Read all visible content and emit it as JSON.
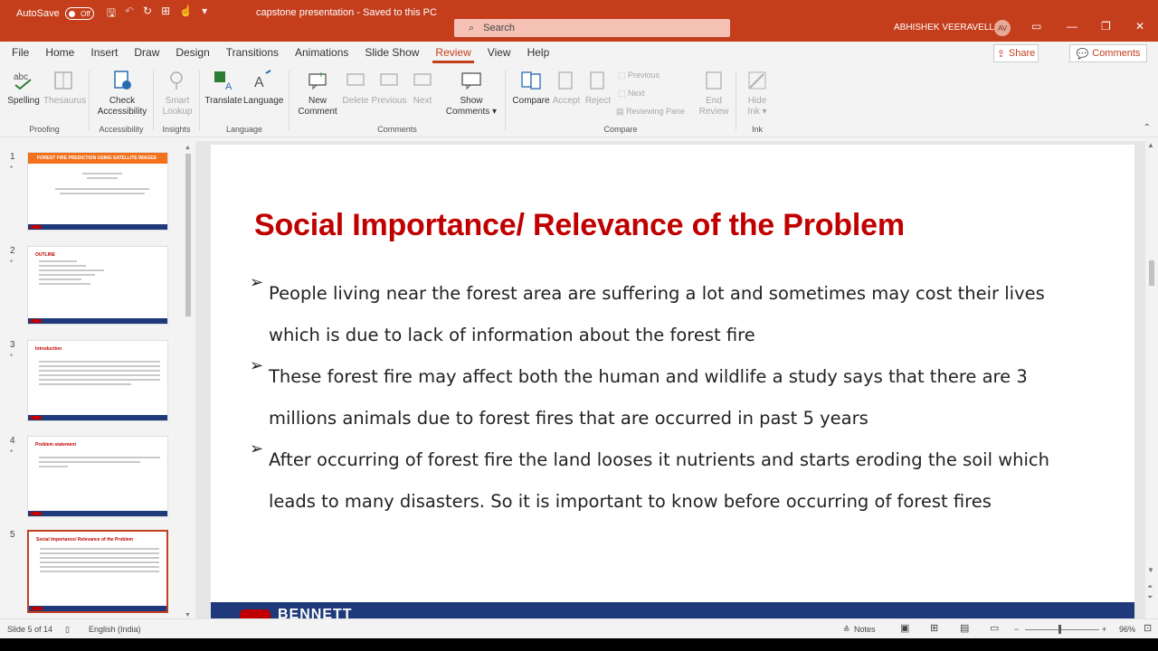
{
  "titlebar": {
    "autosave_label": "AutoSave",
    "autosave_state": "Off",
    "doc_title": "capstone presentation  -  Saved to this PC",
    "search_placeholder": "Search",
    "user_name": "ABHISHEK VEERAVELLI",
    "user_initials": "AV",
    "color": "#c43e1c"
  },
  "tabs": [
    "File",
    "Home",
    "Insert",
    "Draw",
    "Design",
    "Transitions",
    "Animations",
    "Slide Show",
    "Review",
    "View",
    "Help"
  ],
  "active_tab": "Review",
  "share_label": "Share",
  "comments_label": "Comments",
  "ribbon": {
    "proofing": {
      "label": "Proofing",
      "spelling": "Spelling",
      "thesaurus": "Thesaurus"
    },
    "accessibility": {
      "label": "Accessibility",
      "check_1": "Check",
      "check_2": "Accessibility"
    },
    "insights": {
      "label": "Insights",
      "smart_1": "Smart",
      "smart_2": "Lookup"
    },
    "language": {
      "label": "Language",
      "translate": "Translate",
      "language": "Language"
    },
    "comments": {
      "label": "Comments",
      "new_1": "New",
      "new_2": "Comment",
      "delete": "Delete",
      "previous": "Previous",
      "next": "Next",
      "show_1": "Show",
      "show_2": "Comments"
    },
    "compare": {
      "label": "Compare",
      "compare": "Compare",
      "accept": "Accept",
      "reject": "Reject",
      "previous": "Previous",
      "next": "Next",
      "reviewing_pane": "Reviewing Pane",
      "end_1": "End",
      "end_2": "Review"
    },
    "ink": {
      "label": "Ink",
      "hide_1": "Hide",
      "hide_2": "Ink"
    }
  },
  "thumbnails": [
    {
      "num": "1",
      "star": "*",
      "title": "FOREST FIRE PREDICTION USING SATELLITE IMAGES"
    },
    {
      "num": "2",
      "star": "*",
      "title": "OUTLINE"
    },
    {
      "num": "3",
      "star": "*",
      "title": "Introduction"
    },
    {
      "num": "4",
      "star": "*",
      "title": "Problem statement"
    },
    {
      "num": "5",
      "star": "*",
      "title": "Social Importance/ Relevance of the Problem"
    }
  ],
  "slide": {
    "title": "Social Importance/ Relevance of the Problem",
    "bullet_symbol": "➢",
    "bullets": [
      "People living near the forest area are suffering a lot and sometimes may cost their lives which is due to lack of information about the forest fire",
      "These forest fire may affect both the human and wildlife a study says that there are 3 millions animals due to forest fires that are occurred in past 5 years",
      "After occurring of forest fire the land looses it nutrients and starts eroding the soil which leads to many disasters. So it is important to know before occurring of forest fires"
    ],
    "footer_logo_text": "BENNETT"
  },
  "status": {
    "slide_info": "Slide 5 of 14",
    "language": "English (India)",
    "notes": "Notes",
    "zoom": "96%"
  }
}
